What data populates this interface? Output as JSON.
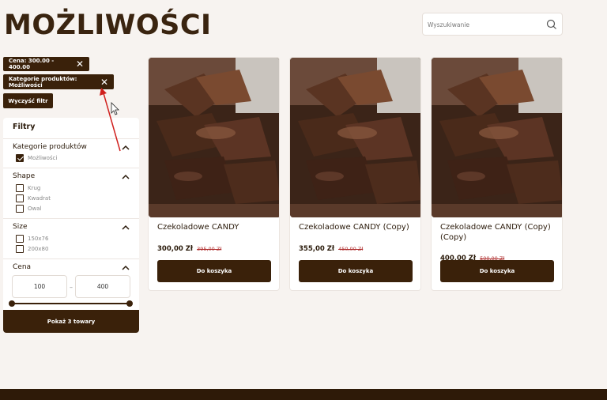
{
  "page": {
    "title": "MOŻLIWOŚCI"
  },
  "search": {
    "placeholder": "Wyszukiwanie",
    "icon": "search-icon"
  },
  "active_filters": {
    "price_chip": "Cena: 300.00 - 400.00",
    "category_chip": "Kategorie produktów: Możliwości",
    "clear_label": "Wyczyść filtr"
  },
  "filters": {
    "title": "Filtry",
    "category": {
      "title": "Kategorie produktów",
      "options": [
        {
          "label": "Możliwości",
          "checked": true
        }
      ]
    },
    "shape": {
      "title": "Shape",
      "options": [
        {
          "label": "Krug",
          "checked": false
        },
        {
          "label": "Kwadrat",
          "checked": false
        },
        {
          "label": "Owal",
          "checked": false
        }
      ]
    },
    "size": {
      "title": "Size",
      "options": [
        {
          "label": "150x76",
          "checked": false
        },
        {
          "label": "200x80",
          "checked": false
        }
      ]
    },
    "price": {
      "title": "Cena",
      "min": "100",
      "max": "400",
      "separator": "–"
    },
    "apply_label": "Pokaż 3 towary"
  },
  "products": [
    {
      "name": "Czekoladowe CANDY",
      "price": "300,00 Zł",
      "old_price": "395,00 Zł",
      "button": "Do koszyka"
    },
    {
      "name": "Czekoladowe CANDY (Copy)",
      "price": "355,00 Zł",
      "old_price": "450,00 Zł",
      "button": "Do koszyka"
    },
    {
      "name": "Czekoladowe CANDY (Copy) (Copy)",
      "price": "400,00 Zł",
      "old_price": "500,00 Zł",
      "button": "Do koszyka"
    }
  ],
  "colors": {
    "brand": "#3a210a",
    "background": "#f7f3f0",
    "sale": "#b03030",
    "annotation": "#d0201e"
  }
}
